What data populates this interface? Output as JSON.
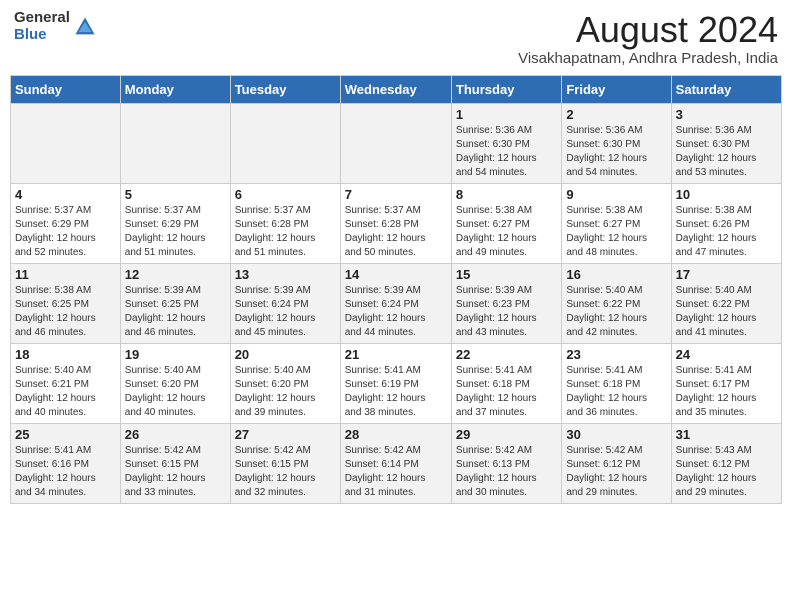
{
  "header": {
    "logo_general": "General",
    "logo_blue": "Blue",
    "month_year": "August 2024",
    "location": "Visakhapatnam, Andhra Pradesh, India"
  },
  "days_of_week": [
    "Sunday",
    "Monday",
    "Tuesday",
    "Wednesday",
    "Thursday",
    "Friday",
    "Saturday"
  ],
  "weeks": [
    [
      {
        "day": "",
        "info": ""
      },
      {
        "day": "",
        "info": ""
      },
      {
        "day": "",
        "info": ""
      },
      {
        "day": "",
        "info": ""
      },
      {
        "day": "1",
        "info": "Sunrise: 5:36 AM\nSunset: 6:30 PM\nDaylight: 12 hours\nand 54 minutes."
      },
      {
        "day": "2",
        "info": "Sunrise: 5:36 AM\nSunset: 6:30 PM\nDaylight: 12 hours\nand 54 minutes."
      },
      {
        "day": "3",
        "info": "Sunrise: 5:36 AM\nSunset: 6:30 PM\nDaylight: 12 hours\nand 53 minutes."
      }
    ],
    [
      {
        "day": "4",
        "info": "Sunrise: 5:37 AM\nSunset: 6:29 PM\nDaylight: 12 hours\nand 52 minutes."
      },
      {
        "day": "5",
        "info": "Sunrise: 5:37 AM\nSunset: 6:29 PM\nDaylight: 12 hours\nand 51 minutes."
      },
      {
        "day": "6",
        "info": "Sunrise: 5:37 AM\nSunset: 6:28 PM\nDaylight: 12 hours\nand 51 minutes."
      },
      {
        "day": "7",
        "info": "Sunrise: 5:37 AM\nSunset: 6:28 PM\nDaylight: 12 hours\nand 50 minutes."
      },
      {
        "day": "8",
        "info": "Sunrise: 5:38 AM\nSunset: 6:27 PM\nDaylight: 12 hours\nand 49 minutes."
      },
      {
        "day": "9",
        "info": "Sunrise: 5:38 AM\nSunset: 6:27 PM\nDaylight: 12 hours\nand 48 minutes."
      },
      {
        "day": "10",
        "info": "Sunrise: 5:38 AM\nSunset: 6:26 PM\nDaylight: 12 hours\nand 47 minutes."
      }
    ],
    [
      {
        "day": "11",
        "info": "Sunrise: 5:38 AM\nSunset: 6:25 PM\nDaylight: 12 hours\nand 46 minutes."
      },
      {
        "day": "12",
        "info": "Sunrise: 5:39 AM\nSunset: 6:25 PM\nDaylight: 12 hours\nand 46 minutes."
      },
      {
        "day": "13",
        "info": "Sunrise: 5:39 AM\nSunset: 6:24 PM\nDaylight: 12 hours\nand 45 minutes."
      },
      {
        "day": "14",
        "info": "Sunrise: 5:39 AM\nSunset: 6:24 PM\nDaylight: 12 hours\nand 44 minutes."
      },
      {
        "day": "15",
        "info": "Sunrise: 5:39 AM\nSunset: 6:23 PM\nDaylight: 12 hours\nand 43 minutes."
      },
      {
        "day": "16",
        "info": "Sunrise: 5:40 AM\nSunset: 6:22 PM\nDaylight: 12 hours\nand 42 minutes."
      },
      {
        "day": "17",
        "info": "Sunrise: 5:40 AM\nSunset: 6:22 PM\nDaylight: 12 hours\nand 41 minutes."
      }
    ],
    [
      {
        "day": "18",
        "info": "Sunrise: 5:40 AM\nSunset: 6:21 PM\nDaylight: 12 hours\nand 40 minutes."
      },
      {
        "day": "19",
        "info": "Sunrise: 5:40 AM\nSunset: 6:20 PM\nDaylight: 12 hours\nand 40 minutes."
      },
      {
        "day": "20",
        "info": "Sunrise: 5:40 AM\nSunset: 6:20 PM\nDaylight: 12 hours\nand 39 minutes."
      },
      {
        "day": "21",
        "info": "Sunrise: 5:41 AM\nSunset: 6:19 PM\nDaylight: 12 hours\nand 38 minutes."
      },
      {
        "day": "22",
        "info": "Sunrise: 5:41 AM\nSunset: 6:18 PM\nDaylight: 12 hours\nand 37 minutes."
      },
      {
        "day": "23",
        "info": "Sunrise: 5:41 AM\nSunset: 6:18 PM\nDaylight: 12 hours\nand 36 minutes."
      },
      {
        "day": "24",
        "info": "Sunrise: 5:41 AM\nSunset: 6:17 PM\nDaylight: 12 hours\nand 35 minutes."
      }
    ],
    [
      {
        "day": "25",
        "info": "Sunrise: 5:41 AM\nSunset: 6:16 PM\nDaylight: 12 hours\nand 34 minutes."
      },
      {
        "day": "26",
        "info": "Sunrise: 5:42 AM\nSunset: 6:15 PM\nDaylight: 12 hours\nand 33 minutes."
      },
      {
        "day": "27",
        "info": "Sunrise: 5:42 AM\nSunset: 6:15 PM\nDaylight: 12 hours\nand 32 minutes."
      },
      {
        "day": "28",
        "info": "Sunrise: 5:42 AM\nSunset: 6:14 PM\nDaylight: 12 hours\nand 31 minutes."
      },
      {
        "day": "29",
        "info": "Sunrise: 5:42 AM\nSunset: 6:13 PM\nDaylight: 12 hours\nand 30 minutes."
      },
      {
        "day": "30",
        "info": "Sunrise: 5:42 AM\nSunset: 6:12 PM\nDaylight: 12 hours\nand 29 minutes."
      },
      {
        "day": "31",
        "info": "Sunrise: 5:43 AM\nSunset: 6:12 PM\nDaylight: 12 hours\nand 29 minutes."
      }
    ]
  ]
}
